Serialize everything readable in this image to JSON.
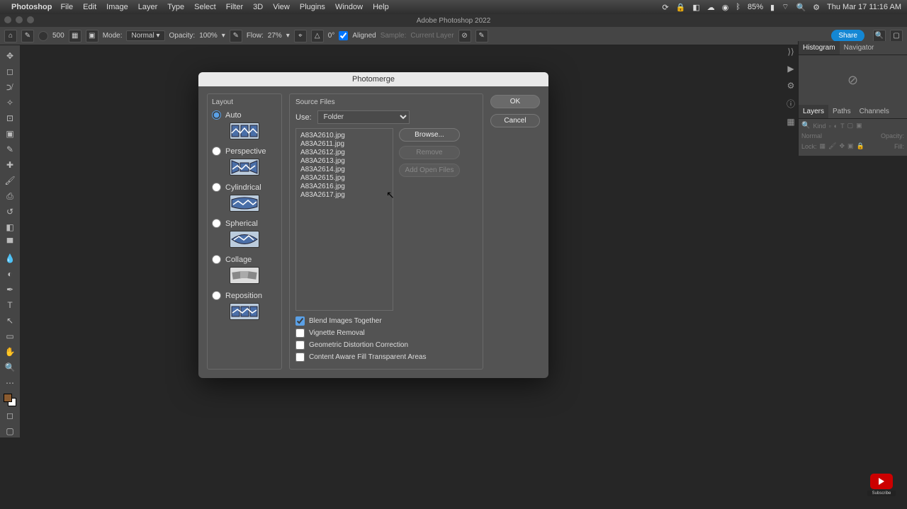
{
  "menubar": {
    "app": "Photoshop",
    "items": [
      "File",
      "Edit",
      "Image",
      "Layer",
      "Type",
      "Select",
      "Filter",
      "3D",
      "View",
      "Plugins",
      "Window",
      "Help"
    ],
    "battery": "85%",
    "clock": "Thu Mar 17  11:16 AM"
  },
  "window_title": "Adobe Photoshop 2022",
  "optbar": {
    "brush_size": "500",
    "mode_label": "Mode:",
    "mode_value": "Normal",
    "opacity_label": "Opacity:",
    "opacity_value": "100%",
    "flow_label": "Flow:",
    "flow_value": "27%",
    "angle_value": "0°",
    "aligned_label": "Aligned",
    "sample_label": "Sample:",
    "sample_value": "Current Layer",
    "share": "Share"
  },
  "panels": {
    "histogram_tab": "Histogram",
    "navigator_tab": "Navigator",
    "layers_tab": "Layers",
    "paths_tab": "Paths",
    "channels_tab": "Channels",
    "kind_label": "Kind",
    "blend_value": "Normal",
    "opacity_label": "Opacity:",
    "lock_label": "Lock:",
    "fill_label": "Fill:"
  },
  "dialog": {
    "title": "Photomerge",
    "layout_label": "Layout",
    "options": {
      "auto": "Auto",
      "perspective": "Perspective",
      "cylindrical": "Cylindrical",
      "spherical": "Spherical",
      "collage": "Collage",
      "reposition": "Reposition"
    },
    "selected_layout": "auto",
    "source_label": "Source Files",
    "use_label": "Use:",
    "use_value": "Folder",
    "files": [
      "A83A2610.jpg",
      "A83A2611.jpg",
      "A83A2612.jpg",
      "A83A2613.jpg",
      "A83A2614.jpg",
      "A83A2615.jpg",
      "A83A2616.jpg",
      "A83A2617.jpg"
    ],
    "browse": "Browse...",
    "remove": "Remove",
    "add_open": "Add Open Files",
    "checks": {
      "blend": "Blend Images Together",
      "vignette": "Vignette Removal",
      "geo": "Geometric Distortion Correction",
      "caf": "Content Aware Fill Transparent Areas"
    },
    "ok": "OK",
    "cancel": "Cancel"
  },
  "yt_sub": "Subscribe"
}
